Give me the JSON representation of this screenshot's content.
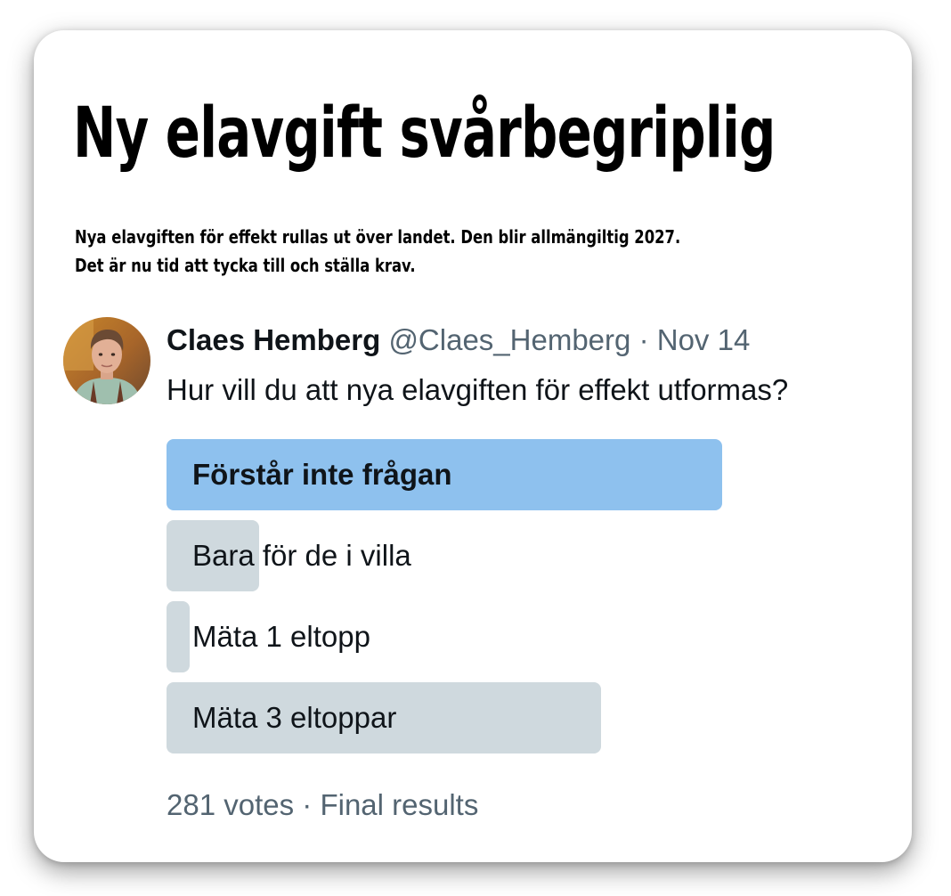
{
  "headline": "Ny elavgift svårbegriplig",
  "lede": [
    "Nya elavgiften för effekt rullas ut över landet. Den blir allmängiltig 2027.",
    "Det är nu tid att tycka till och ställa krav."
  ],
  "tweet": {
    "author_name": "Claes Hemberg",
    "handle": "@Claes_Hemberg",
    "separator": "·",
    "date": "Nov 14",
    "text": "Hur vill du att nya elavgiften för effekt utformas?",
    "avatar": "profile-photo"
  },
  "poll": {
    "options": [
      {
        "label": "Förstår inte frågan",
        "share": 0.78,
        "winner": true
      },
      {
        "label": "Bara för de i villa",
        "share": 0.13,
        "winner": false
      },
      {
        "label": "Mäta 1 eltopp",
        "share": 0.03,
        "winner": false
      },
      {
        "label": "Mäta 3 eltoppar",
        "share": 0.61,
        "winner": false
      }
    ],
    "votes": "281 votes",
    "separator": "·",
    "status": "Final results"
  },
  "colors": {
    "winner_bar": "#8ec1ee",
    "other_bar": "#cfd9de",
    "text": "#0f1419",
    "secondary_text": "#536471"
  }
}
